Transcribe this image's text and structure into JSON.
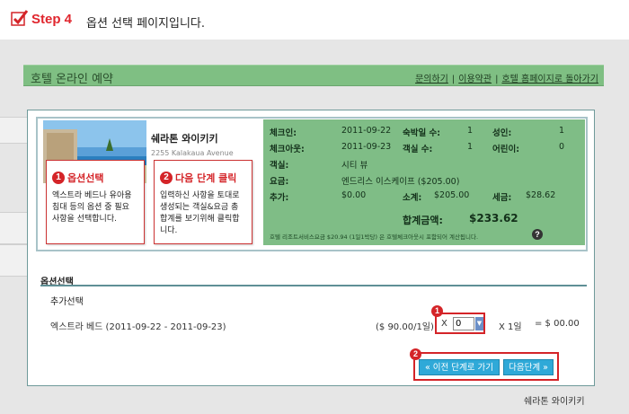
{
  "step": {
    "title": "Step 4",
    "description": "옵션 선택 페이지입니다."
  },
  "header": {
    "title": "호텔 온라인 예약",
    "links": [
      "문의하기",
      "이용약관",
      "호텔 홈페이지로 돌아가기"
    ]
  },
  "hotel": {
    "name": "쉐라톤 와이키키",
    "address": "2255 Kalakaua Avenue"
  },
  "callouts": [
    {
      "num": "1",
      "title": "옵션선택",
      "body": "엑스트라 베드나 유아용 침대 등의 옵션 중 필요 사항을 선택합니다."
    },
    {
      "num": "2",
      "title": "다음 단계 클릭",
      "body": "입력하신 사항을 토대로 생성되는 객실&요금 총 합계를 보기위해 클릭합니다."
    }
  ],
  "reservation": {
    "checkin_label": "체크인:",
    "checkin": "2011-09-22",
    "nights_label": "숙박일 수:",
    "nights": "1",
    "adults_label": "성인:",
    "adults": "1",
    "checkout_label": "체크아웃:",
    "checkout": "2011-09-23",
    "rooms_label": "객실 수:",
    "rooms": "1",
    "children_label": "어린이:",
    "children": "0",
    "room_label": "객실:",
    "room": "시티 뷰",
    "rate_label": "요금:",
    "rate": "엔드리스 이스케이프 ($205.00)",
    "extra_label": "추가:",
    "extra": "$0.00",
    "subtotal_label": "소계:",
    "subtotal": "$205.00",
    "tax_label": "세금:",
    "tax": "$28.62",
    "total_label": "합계금액:",
    "total": "$233.62",
    "note": "호텔 리조트서비스요금 $20.94 (1일1박당) 은 호텔체크아웃시 포함되어 계산됩니다."
  },
  "options": {
    "section_title": "옵션선택",
    "sub_title": "추가선택",
    "item": "엑스트라 베드 (2011-09-22 - 2011-09-23)",
    "price": "($ 90.00/1일)",
    "x": "X",
    "qty": "0",
    "mult": "X 1일",
    "total": "= $ 00.00",
    "badge1": "1",
    "badge2": "2"
  },
  "buttons": {
    "prev": "« 이전 단계로 가기",
    "next": "다음단계 »"
  },
  "footer": "쉐라톤 와이키키"
}
